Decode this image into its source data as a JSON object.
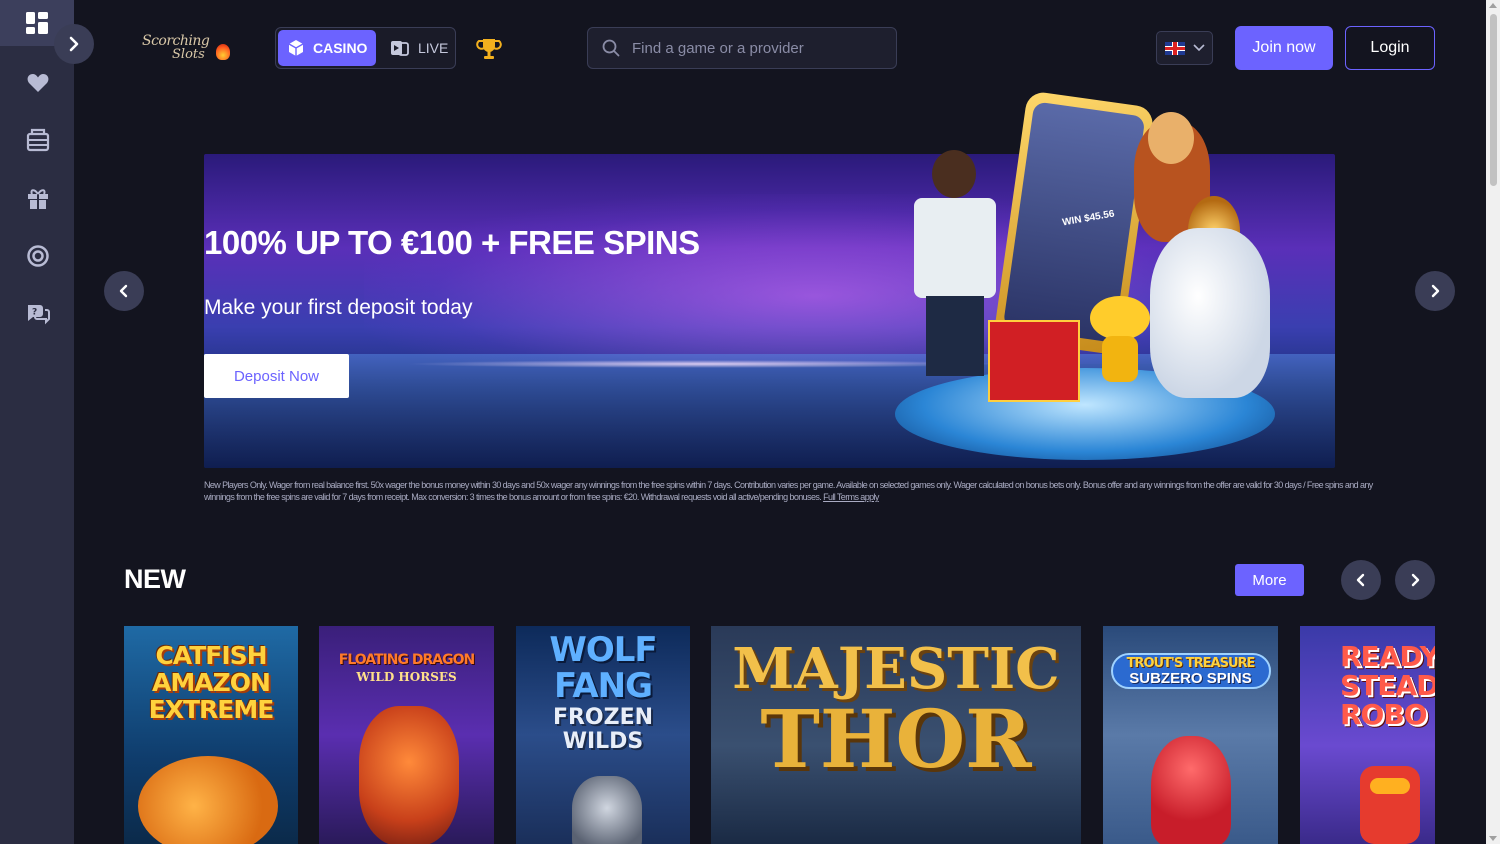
{
  "header": {
    "logo_line1": "Scorching",
    "logo_line2": "Slots",
    "mode_casino": "CASINO",
    "mode_live": "LIVE",
    "search_placeholder": "Find a game or a provider",
    "language": "en-GB",
    "join_label": "Join now",
    "login_label": "Login"
  },
  "sidebar": {
    "items": [
      "lobby",
      "favourites",
      "casino",
      "promotions",
      "live-support",
      "help"
    ]
  },
  "banner": {
    "title": "100% UP TO €100 + FREE SPINS",
    "subtitle": "Make your first deposit today",
    "cta": "Deposit Now",
    "terms": "New Players Only. Wager from real balance first. 50x wager the bonus money within 30 days and 50x wager any winnings from the free spins within 7 days. Contribution varies per game. Available on selected games only. Wager calculated on bonus bets only. Bonus offer and any winnings from the offer are valid for 30 days / Free spins and any winnings from the free spins are valid for 7 days from receipt. Max conversion: 3 times the bonus amount or from free spins: €20. Withdrawal requests void all active/pending bonuses.",
    "terms_link": "Full Terms apply",
    "win_label": "WIN $45.56"
  },
  "new_section": {
    "title": "NEW",
    "more_label": "More",
    "games": [
      {
        "title": "CATFISH AMAZON EXTREME",
        "sub": ""
      },
      {
        "title": "FLOATING DRAGON",
        "sub": "WILD HORSES"
      },
      {
        "title": "WOLF FANG",
        "sub": "FROZEN WILDS"
      },
      {
        "title": "MAJESTIC",
        "sub": "THOR"
      },
      {
        "title": "TROUT'S TREASURE",
        "sub": "SUBZERO SPINS"
      },
      {
        "title": "READY STEADY ROBO",
        "sub": ""
      }
    ]
  },
  "colors": {
    "accent": "#6c63ff",
    "background": "#13141f",
    "sidebar": "#2b2d42"
  }
}
